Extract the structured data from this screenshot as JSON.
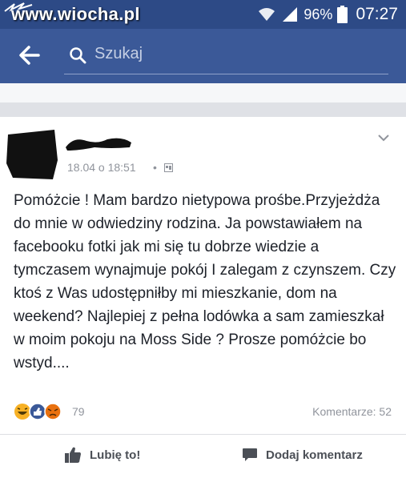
{
  "watermark": "www.wiocha.pl",
  "status_bar": {
    "battery": "96%",
    "time": "07:27"
  },
  "search": {
    "placeholder": "Szukaj"
  },
  "post": {
    "timestamp": "18.04 o 18:51",
    "separator": "•",
    "text": "Pomóżcie ! Mam bardzo nietypowa prośbe.Przyjeżdża do mnie w odwiedziny rodzina. Ja powstawiałem na facebooku fotki jak mi się tu dobrze wiedzie a tymczasem wynajmuje pokój I zalegam z czynszem. Czy ktoś z Was udostępniłby mi mieszkanie, dom na weekend? Najlepiej z pełna lodówka a sam zamieszkał w moim pokoju na Moss Side ? Prosze pomóżcie bo wstyd....",
    "reaction_count": "79",
    "comments": "Komentarze: 52"
  },
  "actions": {
    "like": "Lubię to!",
    "comment": "Dodaj komentarz"
  },
  "icons": [
    "back-arrow-icon",
    "search-icon",
    "chevron-down-icon",
    "privacy-icon",
    "haha-reaction-icon",
    "like-reaction-icon",
    "angry-reaction-icon",
    "thumbs-up-icon",
    "comment-bubble-icon",
    "wifi-icon",
    "signal-icon",
    "battery-icon"
  ],
  "colors": {
    "facebook_blue": "#3b5998",
    "status_bar": "#2d4a86",
    "text": "#1d2129",
    "meta": "#90949c"
  }
}
